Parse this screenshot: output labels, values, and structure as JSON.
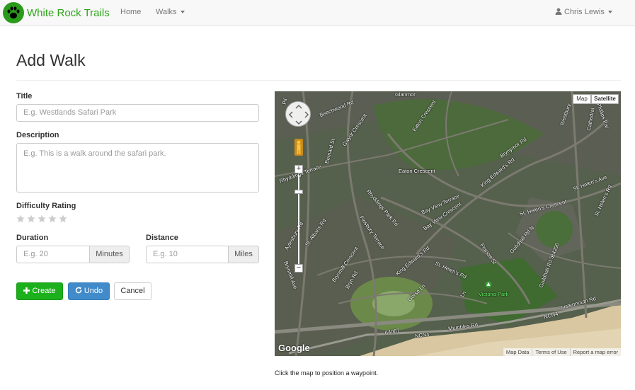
{
  "navbar": {
    "brand": "White Rock Trails",
    "home": "Home",
    "walks": "Walks",
    "user": "Chris Lewis"
  },
  "page": {
    "title": "Add Walk"
  },
  "form": {
    "title_label": "Title",
    "title_placeholder": "E.g. Westlands Safari Park",
    "description_label": "Description",
    "description_placeholder": "E.g. This is a walk around the safari park.",
    "difficulty_label": "Difficulty Rating",
    "difficulty_value": 0,
    "difficulty_max": 5,
    "duration_label": "Duration",
    "duration_placeholder": "E.g. 20",
    "duration_unit": "Minutes",
    "distance_label": "Distance",
    "distance_placeholder": "E.g. 10",
    "distance_unit": "Miles"
  },
  "buttons": {
    "create": "Create",
    "undo": "Undo",
    "cancel": "Cancel"
  },
  "map": {
    "type_map": "Map",
    "type_satellite": "Satellite",
    "active_type": "Satellite",
    "zoom_in": "+",
    "zoom_out": "−",
    "google": "Google",
    "footer": [
      "Map Data",
      "Terms of Use",
      "Report a map error"
    ],
    "caption": "Click the map to position a waypoint.",
    "streets": [
      "Beechwood Rd",
      "Gwydr Crescent",
      "Eaton Crescent",
      "Eaton Crescent",
      "Brynymor Rd",
      "Westbury",
      "Phillips Par",
      "Cathedral",
      "Rhyddings Terrace",
      "Rhyddings Park Rd",
      "Bay View Terrace",
      "Bay View Crescent",
      "King Edward's Rd",
      "St. Helen's Ave",
      "St. Helen's Crescent",
      "St. Helen's Rd",
      "Aylesbury Rd",
      "St. Albans Rd",
      "Finsbury Terrace",
      "Guildhall Rd N",
      "Bernard St",
      "Brynmill Crescent",
      "Bryn Rd",
      "Brynmill Ave",
      "King Edward's Rd",
      "St. Helen's Rd",
      "Francis St",
      "Gorse Ln",
      "Guildhall Rd S",
      "B4290",
      "Oystermouth Rd",
      "Mumbles Rd",
      "A4067",
      "NCN4",
      "NCN4",
      "Victoria Park",
      "Glanmor",
      "Pil",
      "Ln"
    ]
  }
}
